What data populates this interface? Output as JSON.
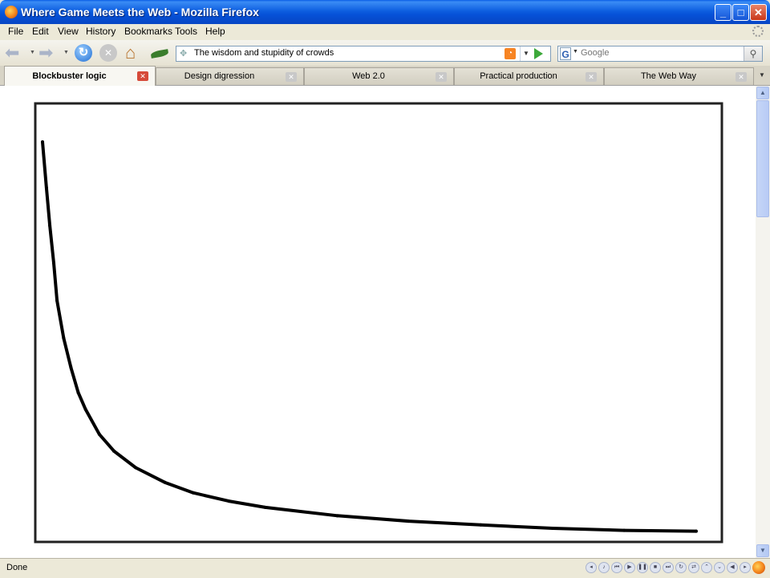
{
  "window": {
    "title": "Where Game Meets the Web - Mozilla Firefox"
  },
  "menu": [
    "File",
    "Edit",
    "View",
    "History",
    "Bookmarks",
    "Tools",
    "Help"
  ],
  "toolbar": {
    "url": "The wisdom and stupidity of crowds",
    "search_placeholder": "Google"
  },
  "tabs": [
    {
      "label": "Blockbuster logic",
      "active": true
    },
    {
      "label": "Design digression",
      "active": false
    },
    {
      "label": "Web 2.0",
      "active": false
    },
    {
      "label": "Practical production",
      "active": false
    },
    {
      "label": "The Web Way",
      "active": false
    }
  ],
  "status": {
    "text": "Done"
  },
  "colors": {
    "titlebar": "#0652d8",
    "chrome": "#ece9d8",
    "curve": "#000000"
  },
  "chart_data": {
    "type": "line",
    "title": "",
    "xlabel": "",
    "ylabel": "",
    "xlim": [
      0,
      100
    ],
    "ylim": [
      0,
      100
    ],
    "grid": false,
    "series": [
      {
        "x": [
          0,
          0.6,
          1.1,
          1.7,
          2.2,
          3.2,
          4.3,
          5.4,
          6.5,
          8.6,
          10.8,
          14.1,
          18.5,
          22.8,
          28.2,
          33.7,
          44.6,
          55.4,
          66.3,
          77.2,
          88,
          98.9
        ],
        "y": [
          95,
          84,
          75,
          66,
          57,
          48,
          41,
          35,
          31,
          25,
          21,
          17,
          13.5,
          11,
          9,
          7.5,
          5.5,
          4.2,
          3.3,
          2.5,
          2,
          1.8
        ]
      }
    ]
  }
}
